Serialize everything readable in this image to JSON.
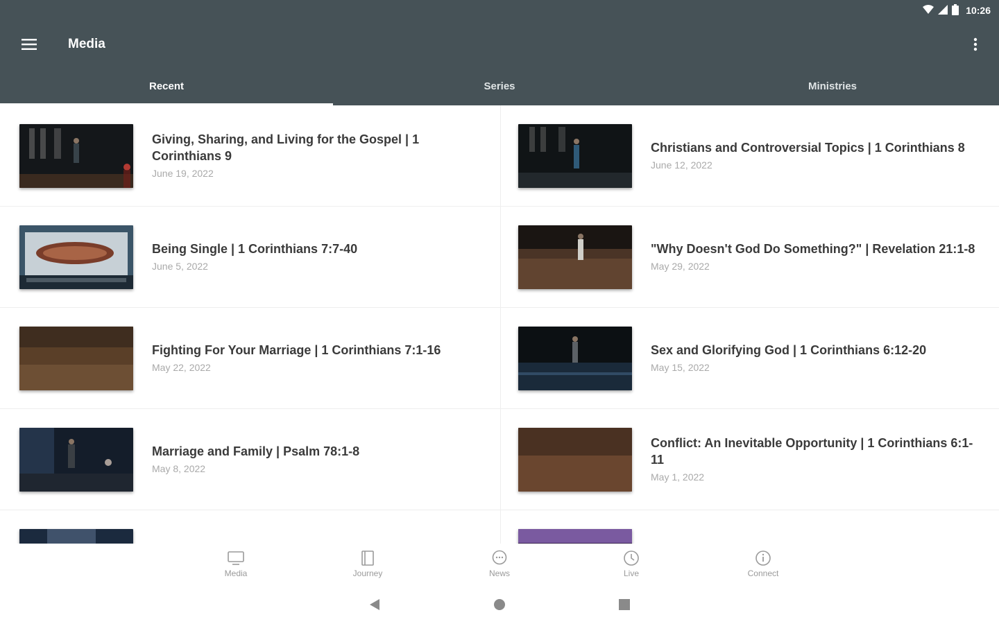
{
  "status_bar": {
    "time": "10:26",
    "icons": [
      "wifi-icon",
      "signal-icon",
      "battery-icon"
    ]
  },
  "app_bar": {
    "title": "Media",
    "menu_icon": "hamburger-menu-icon",
    "overflow_icon": "more-vertical-icon"
  },
  "tabs": [
    {
      "label": "Recent",
      "active": true
    },
    {
      "label": "Series",
      "active": false
    },
    {
      "label": "Ministries",
      "active": false
    }
  ],
  "items": [
    {
      "title": "Giving, Sharing, and Living for the Gospel | 1 Corinthians 9",
      "date": "June 19, 2022"
    },
    {
      "title": "Christians and Controversial Topics | 1 Corinthians 8",
      "date": "June 12, 2022"
    },
    {
      "title": "Being Single | 1 Corinthians 7:7-40",
      "date": "June 5, 2022"
    },
    {
      "title": "\"Why Doesn't God Do Something?\" | Revelation 21:1-8",
      "date": "May 29, 2022"
    },
    {
      "title": "Fighting For Your Marriage | 1 Corinthians 7:1-16",
      "date": "May 22, 2022"
    },
    {
      "title": "Sex and Glorifying God | 1 Corinthians 6:12-20",
      "date": "May 15, 2022"
    },
    {
      "title": "Marriage and Family | Psalm 78:1-8",
      "date": "May 8, 2022"
    },
    {
      "title": "Conflict: An Inevitable Opportunity | 1 Corinthians 6:1-11",
      "date": "May 1, 2022"
    },
    {
      "title": "",
      "date": ""
    },
    {
      "title": "",
      "date": ""
    }
  ],
  "bottom_nav": [
    {
      "label": "Media",
      "icon": "tv-icon"
    },
    {
      "label": "Journey",
      "icon": "book-icon"
    },
    {
      "label": "News",
      "icon": "chat-bubble-icon"
    },
    {
      "label": "Live",
      "icon": "clock-icon"
    },
    {
      "label": "Connect",
      "icon": "info-icon"
    }
  ],
  "system_nav": [
    "back-icon",
    "home-icon",
    "recents-icon"
  ],
  "colors": {
    "app_bar": "#465257",
    "tab_indicator": "#ffffff",
    "date_text": "#a9a9a9",
    "nav_inactive": "#9a9a9a"
  }
}
